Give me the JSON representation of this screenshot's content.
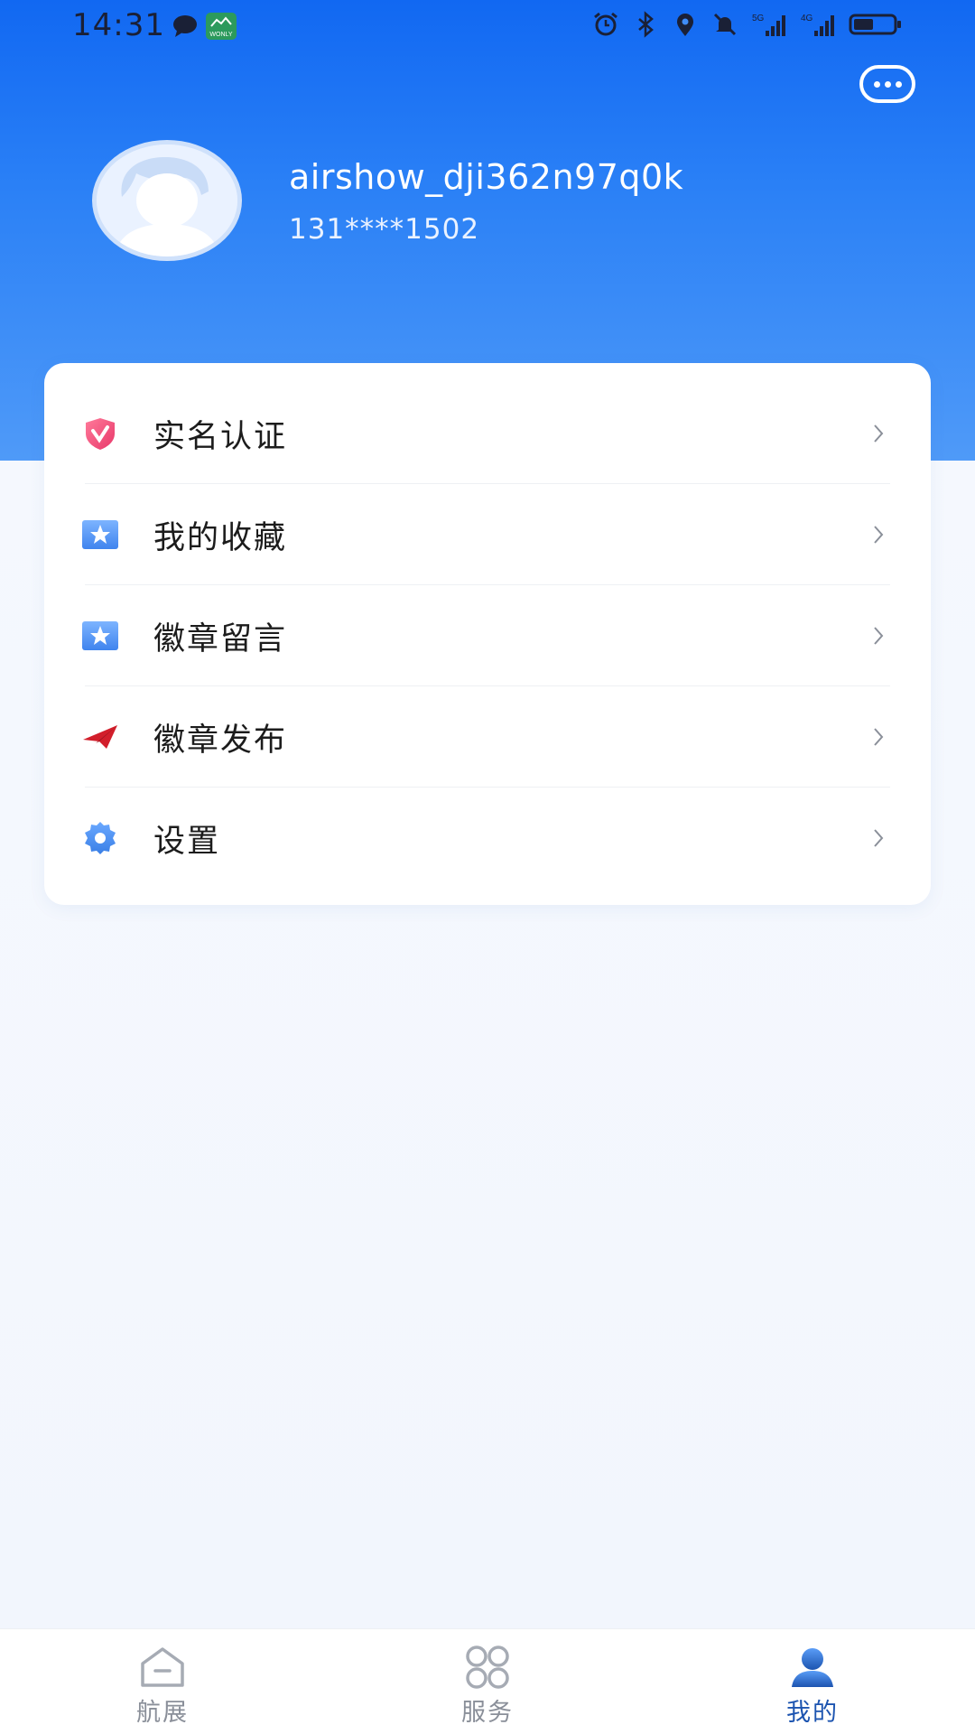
{
  "status_bar": {
    "time": "14:31",
    "left_icons": [
      "message-bubble-icon",
      "wonly-app-icon"
    ],
    "wonly_text": "WONLY",
    "right_icons": [
      "alarm-icon",
      "bluetooth-icon",
      "location-icon",
      "mute-bell-icon",
      "signal-5g-icon",
      "signal-4g-icon",
      "battery-icon"
    ],
    "net1": "5G",
    "net2": "4G",
    "battery_level": 0.5
  },
  "header": {
    "more_icon": "more-dots-icon"
  },
  "profile": {
    "username": "airshow_dji362n97q0k",
    "phone": "131****1502"
  },
  "menu": {
    "items": [
      {
        "label": "实名认证",
        "icon": "verified-shield-icon"
      },
      {
        "label": "我的收藏",
        "icon": "star-favorites-icon"
      },
      {
        "label": "徽章留言",
        "icon": "star-badge-icon"
      },
      {
        "label": "徽章发布",
        "icon": "paper-plane-icon"
      },
      {
        "label": "设置",
        "icon": "gear-icon"
      }
    ]
  },
  "bottom_nav": {
    "items": [
      {
        "label": "航展",
        "icon": "home-icon",
        "active": false
      },
      {
        "label": "服务",
        "icon": "grid-icon",
        "active": false
      },
      {
        "label": "我的",
        "icon": "user-icon",
        "active": true
      }
    ]
  },
  "colors": {
    "header_top": "#1168f2",
    "header_bottom": "#4f9af8",
    "active_nav": "#1c54b0",
    "inactive_nav": "#8a8f99"
  }
}
